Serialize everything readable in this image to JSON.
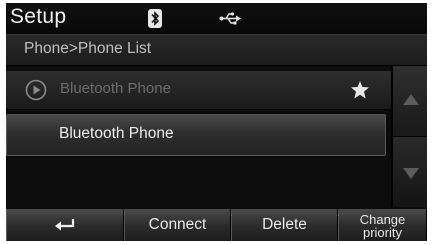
{
  "header": {
    "title": "Setup",
    "icons": [
      "bluetooth-icon",
      "usb-icon"
    ]
  },
  "breadcrumb": "Phone>Phone List",
  "list": {
    "items": [
      {
        "label": "Bluetooth Phone",
        "icon": "play-circle-icon",
        "favorite": true,
        "state": "connected-dimmed"
      },
      {
        "label": "Bluetooth Phone",
        "state": "selected"
      }
    ]
  },
  "scroll": {
    "up_icon": "arrow-up-icon",
    "down_icon": "arrow-down-icon"
  },
  "bottom_bar": {
    "back_icon": "back-arrow-icon",
    "connect_label": "Connect",
    "delete_label": "Delete",
    "change_priority_label": "Change priority"
  },
  "colors": {
    "background": "#0c0c0c",
    "text": "#ededed",
    "dim_text": "#6c6c6c",
    "star": "#e8e8e8"
  }
}
